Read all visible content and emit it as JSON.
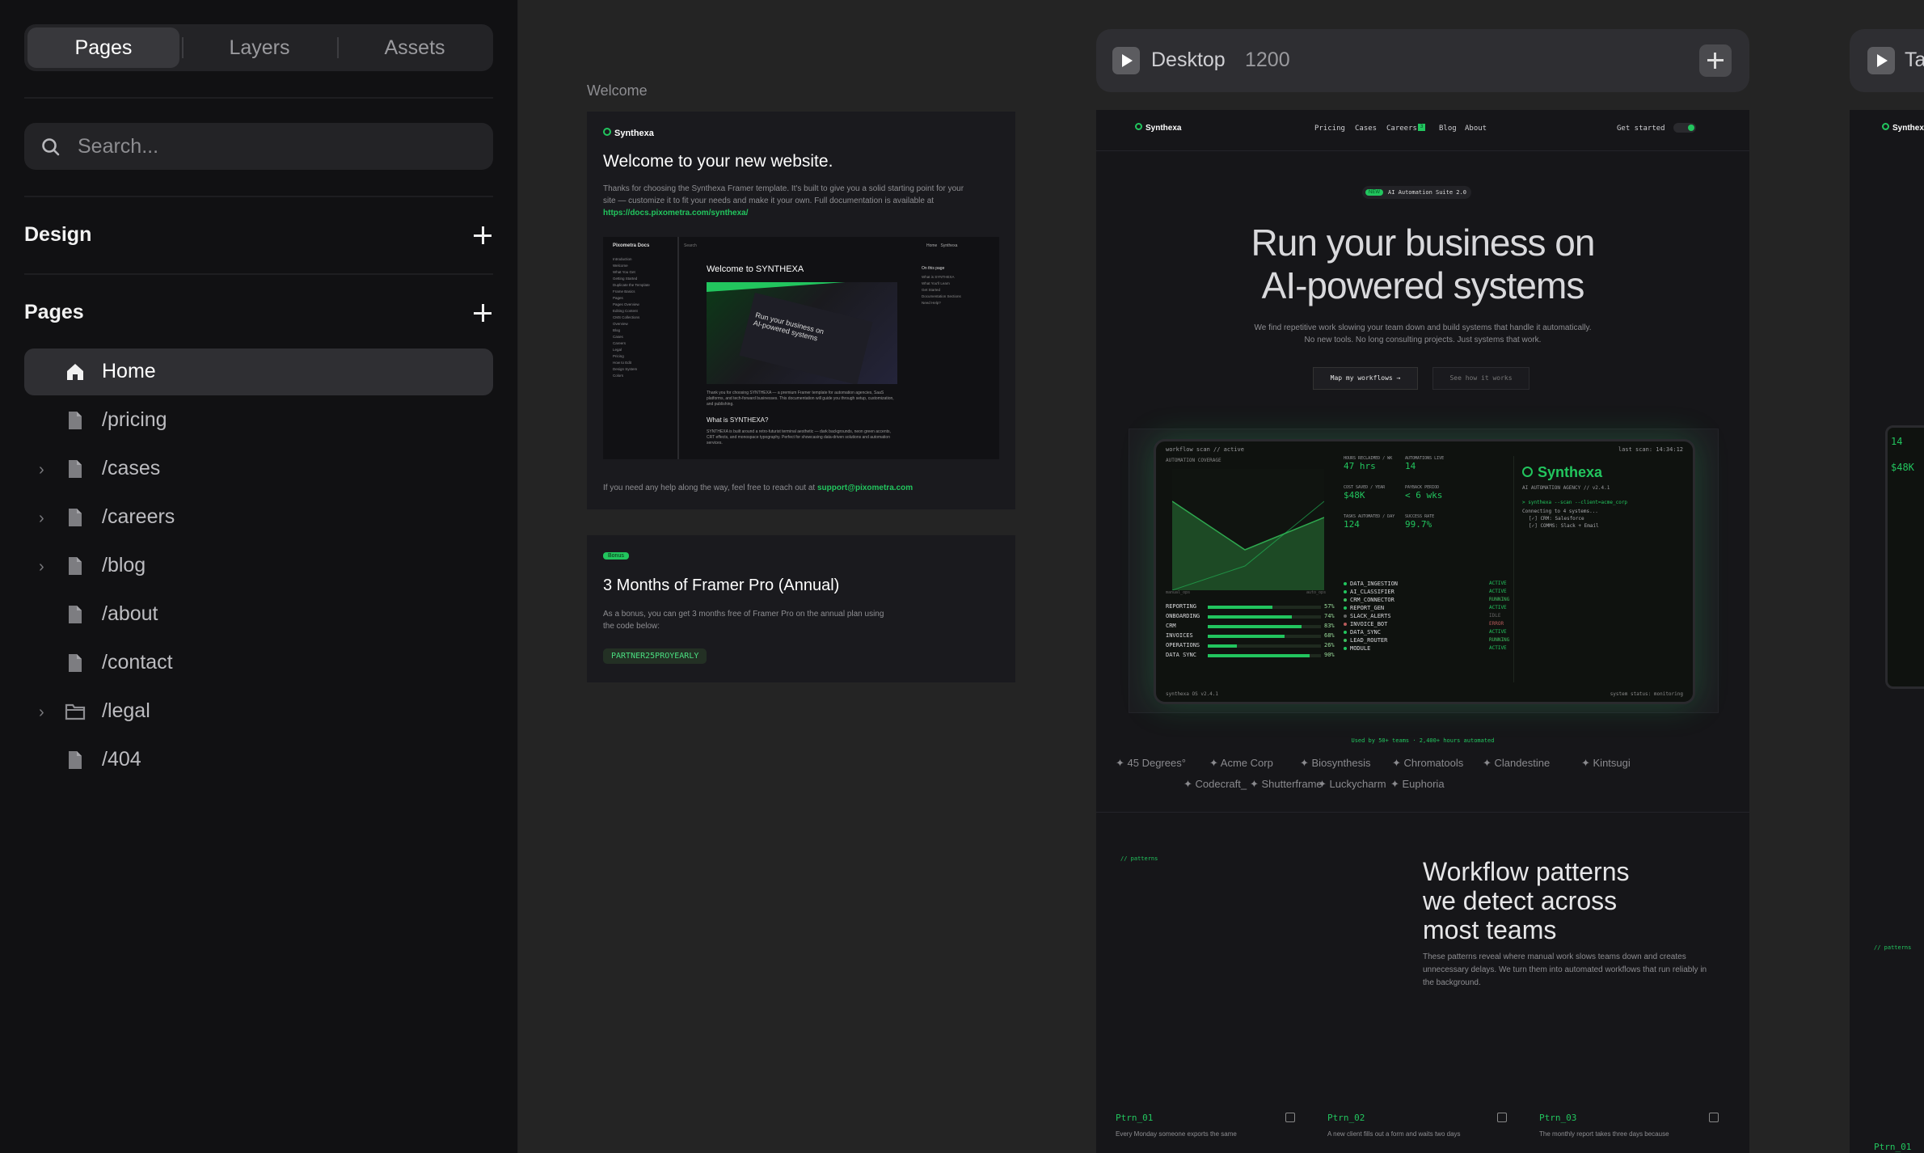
{
  "sidebar": {
    "tabs": [
      "Pages",
      "Layers",
      "Assets"
    ],
    "search_placeholder": "Search...",
    "design_label": "Design",
    "pages_label": "Pages",
    "pages": [
      {
        "label": "Home",
        "icon": "home-icon",
        "expandable": false,
        "active": true
      },
      {
        "label": "/pricing",
        "icon": "page-icon",
        "expandable": false
      },
      {
        "label": "/cases",
        "icon": "page-icon",
        "expandable": true
      },
      {
        "label": "/careers",
        "icon": "page-icon",
        "expandable": true
      },
      {
        "label": "/blog",
        "icon": "page-icon",
        "expandable": true
      },
      {
        "label": "/about",
        "icon": "page-icon",
        "expandable": false
      },
      {
        "label": "/contact",
        "icon": "page-icon",
        "expandable": false
      },
      {
        "label": "/legal",
        "icon": "folder-icon",
        "expandable": true
      },
      {
        "label": "/404",
        "icon": "page-icon",
        "expandable": false
      }
    ]
  },
  "welcome": {
    "frame_label": "Welcome",
    "brand": "Synthexa",
    "title": "Welcome to your new website.",
    "body": "Thanks for choosing the Synthexa Framer template. It's built to give you a solid starting point for your site — customize it to fit your needs and make it your own. Full documentation is available at",
    "docs_link": "https://docs.pixometra.com/synthexa/",
    "preview": {
      "sidebar_title": "Pixometra Docs",
      "nav": [
        "Introduction",
        "Welcome",
        "What You Get",
        "Getting Started",
        "Duplicate the Template",
        "Frame Basics",
        "Pages",
        "Pages Overview",
        "Editing Content",
        "CMS Collections",
        "Overview",
        "Blog",
        "Cases",
        "Careers",
        "Legal",
        "Pricing",
        "How to Edit",
        "Design System",
        "Colors"
      ],
      "heading": "Welcome to SYNTHEXA",
      "image_text": "Run your business on AI-powered systems",
      "intro": "Thank you for choosing SYNTHEXA — a premium Framer template for automation agencies, SaaS platforms, and tech-forward businesses. This documentation will guide you through setup, customization, and publishing.",
      "what_heading": "What is SYNTHEXA?",
      "what_body": "SYNTHEXA is built around a retro-futurist terminal aesthetic — dark backgrounds, neon green accents, CRT effects, and monospace typography. Perfect for showcasing data-driven solutions and automation services.",
      "toc_title": "On this page",
      "toc": [
        "What is SYNTHEXA",
        "What You'll Learn",
        "Get Started",
        "Documentation Sections",
        "Need Help?"
      ],
      "top_links": [
        "Home",
        "Synthexa"
      ],
      "search": "Search"
    },
    "help_text": "If you need any help along the way, feel free to reach out at",
    "support_email": "support@pixometra.com"
  },
  "bonus": {
    "badge": "Bonus",
    "title": "3 Months of Framer Pro (Annual)",
    "body": "As a bonus, you can get 3 months free of Framer Pro on the annual plan using the code below:",
    "code": "PARTNER25PROYEARLY"
  },
  "desktop": {
    "label": "Desktop",
    "width": "1200",
    "add_button": "+",
    "next_frame_label": "Ta",
    "site": {
      "brand": "Synthexa",
      "nav": [
        "Pricing",
        "Cases",
        "Careers",
        "Blog",
        "About"
      ],
      "careers_badge": "3",
      "cta": "Get started",
      "hero_badge_new": "NEW",
      "hero_badge": "AI Automation Suite 2.0",
      "hero_title_1": "Run your business on",
      "hero_title_2": "AI-powered systems",
      "hero_sub": "We find repetitive work slowing your team down and build systems that handle it automatically. No new tools. No long consulting projects. Just systems that work.",
      "btn_primary": "Map my workflows →",
      "btn_secondary": "See how it works",
      "dash": {
        "top_left": "workflow scan // active",
        "top_right": "last scan: 14:34:12",
        "chart_label": "AUTOMATION COVERAGE",
        "chart_ticks": [
          "manual_ops",
          "auto_ops"
        ],
        "stats": [
          {
            "label": "HOURS RECLAIMED / WK",
            "value": "47 hrs"
          },
          {
            "label": "AUTOMATIONS LIVE",
            "value": "14"
          },
          {
            "label": "COST SAVED / YEAR",
            "value": "$48K"
          },
          {
            "label": "PAYBACK PERIOD",
            "value": "< 6 wks"
          },
          {
            "label": "TASKS AUTOMATED / DAY",
            "value": "124"
          },
          {
            "label": "SUCCESS RATE",
            "value": "99.7%"
          }
        ],
        "bars": [
          {
            "label": "REPORTING",
            "pct": "57%",
            "v": 0.57
          },
          {
            "label": "ONBOARDING",
            "pct": "74%",
            "v": 0.74
          },
          {
            "label": "CRM",
            "pct": "83%",
            "v": 0.83
          },
          {
            "label": "INVOICES",
            "pct": "68%",
            "v": 0.68
          },
          {
            "label": "OPERATIONS",
            "pct": "26%",
            "v": 0.26
          },
          {
            "label": "DATA SYNC",
            "pct": "90%",
            "v": 0.9
          }
        ],
        "modules": [
          {
            "name": "DATA_INGESTION",
            "status": "ACTIVE"
          },
          {
            "name": "AI_CLASSIFIER",
            "status": "ACTIVE"
          },
          {
            "name": "CRM_CONNECTOR",
            "status": "RUNNING"
          },
          {
            "name": "REPORT_GEN",
            "status": "ACTIVE"
          },
          {
            "name": "SLACK_ALERTS",
            "status": "IDLE"
          },
          {
            "name": "INVOICE_BOT",
            "status": "ERROR"
          },
          {
            "name": "DATA_SYNC",
            "status": "ACTIVE"
          },
          {
            "name": "LEAD_ROUTER",
            "status": "RUNNING"
          },
          {
            "name": "MODULE",
            "status": "ACTIVE"
          }
        ],
        "term_brand": "Synthexa",
        "term_sub": "AI AUTOMATION AGENCY  // v2.4.1",
        "term_cmd": "> synthexa --scan --client=acme_corp",
        "term_lines": [
          "Connecting to 4 systems...",
          "[✓] CRM:        Salesforce",
          "[✓] COMMS:      Slack + Email"
        ],
        "footer_left": "synthexa OS v2.4.1",
        "footer_right": "system status: monitoring"
      },
      "logos_caption": "Used by 50+ teams · 2,400+ hours automated",
      "logos": [
        "45 Degrees°",
        "Acme Corp",
        "Biosynthesis",
        "Chromatools",
        "Clandestine",
        "Kintsugi",
        "Codecraft_",
        "Shutterframe",
        "Luckycharm",
        "Euphoria"
      ],
      "patterns_tag": "// patterns",
      "patterns_title": "Workflow patterns we detect across most teams",
      "patterns_body": "These patterns reveal where manual work slows teams down and creates unnecessary delays. We turn them into automated workflows that run reliably in the background.",
      "ptrns": [
        {
          "id": "Ptrn_01",
          "text": "Every Monday someone exports the same"
        },
        {
          "id": "Ptrn_02",
          "text": "A new client fills out a form and waits two days"
        },
        {
          "id": "Ptrn_03",
          "text": "The monthly report takes three days because"
        }
      ]
    }
  },
  "colors": {
    "accent": "#22c55e",
    "sidebar_bg": "#111113",
    "canvas_bg": "#242424"
  }
}
